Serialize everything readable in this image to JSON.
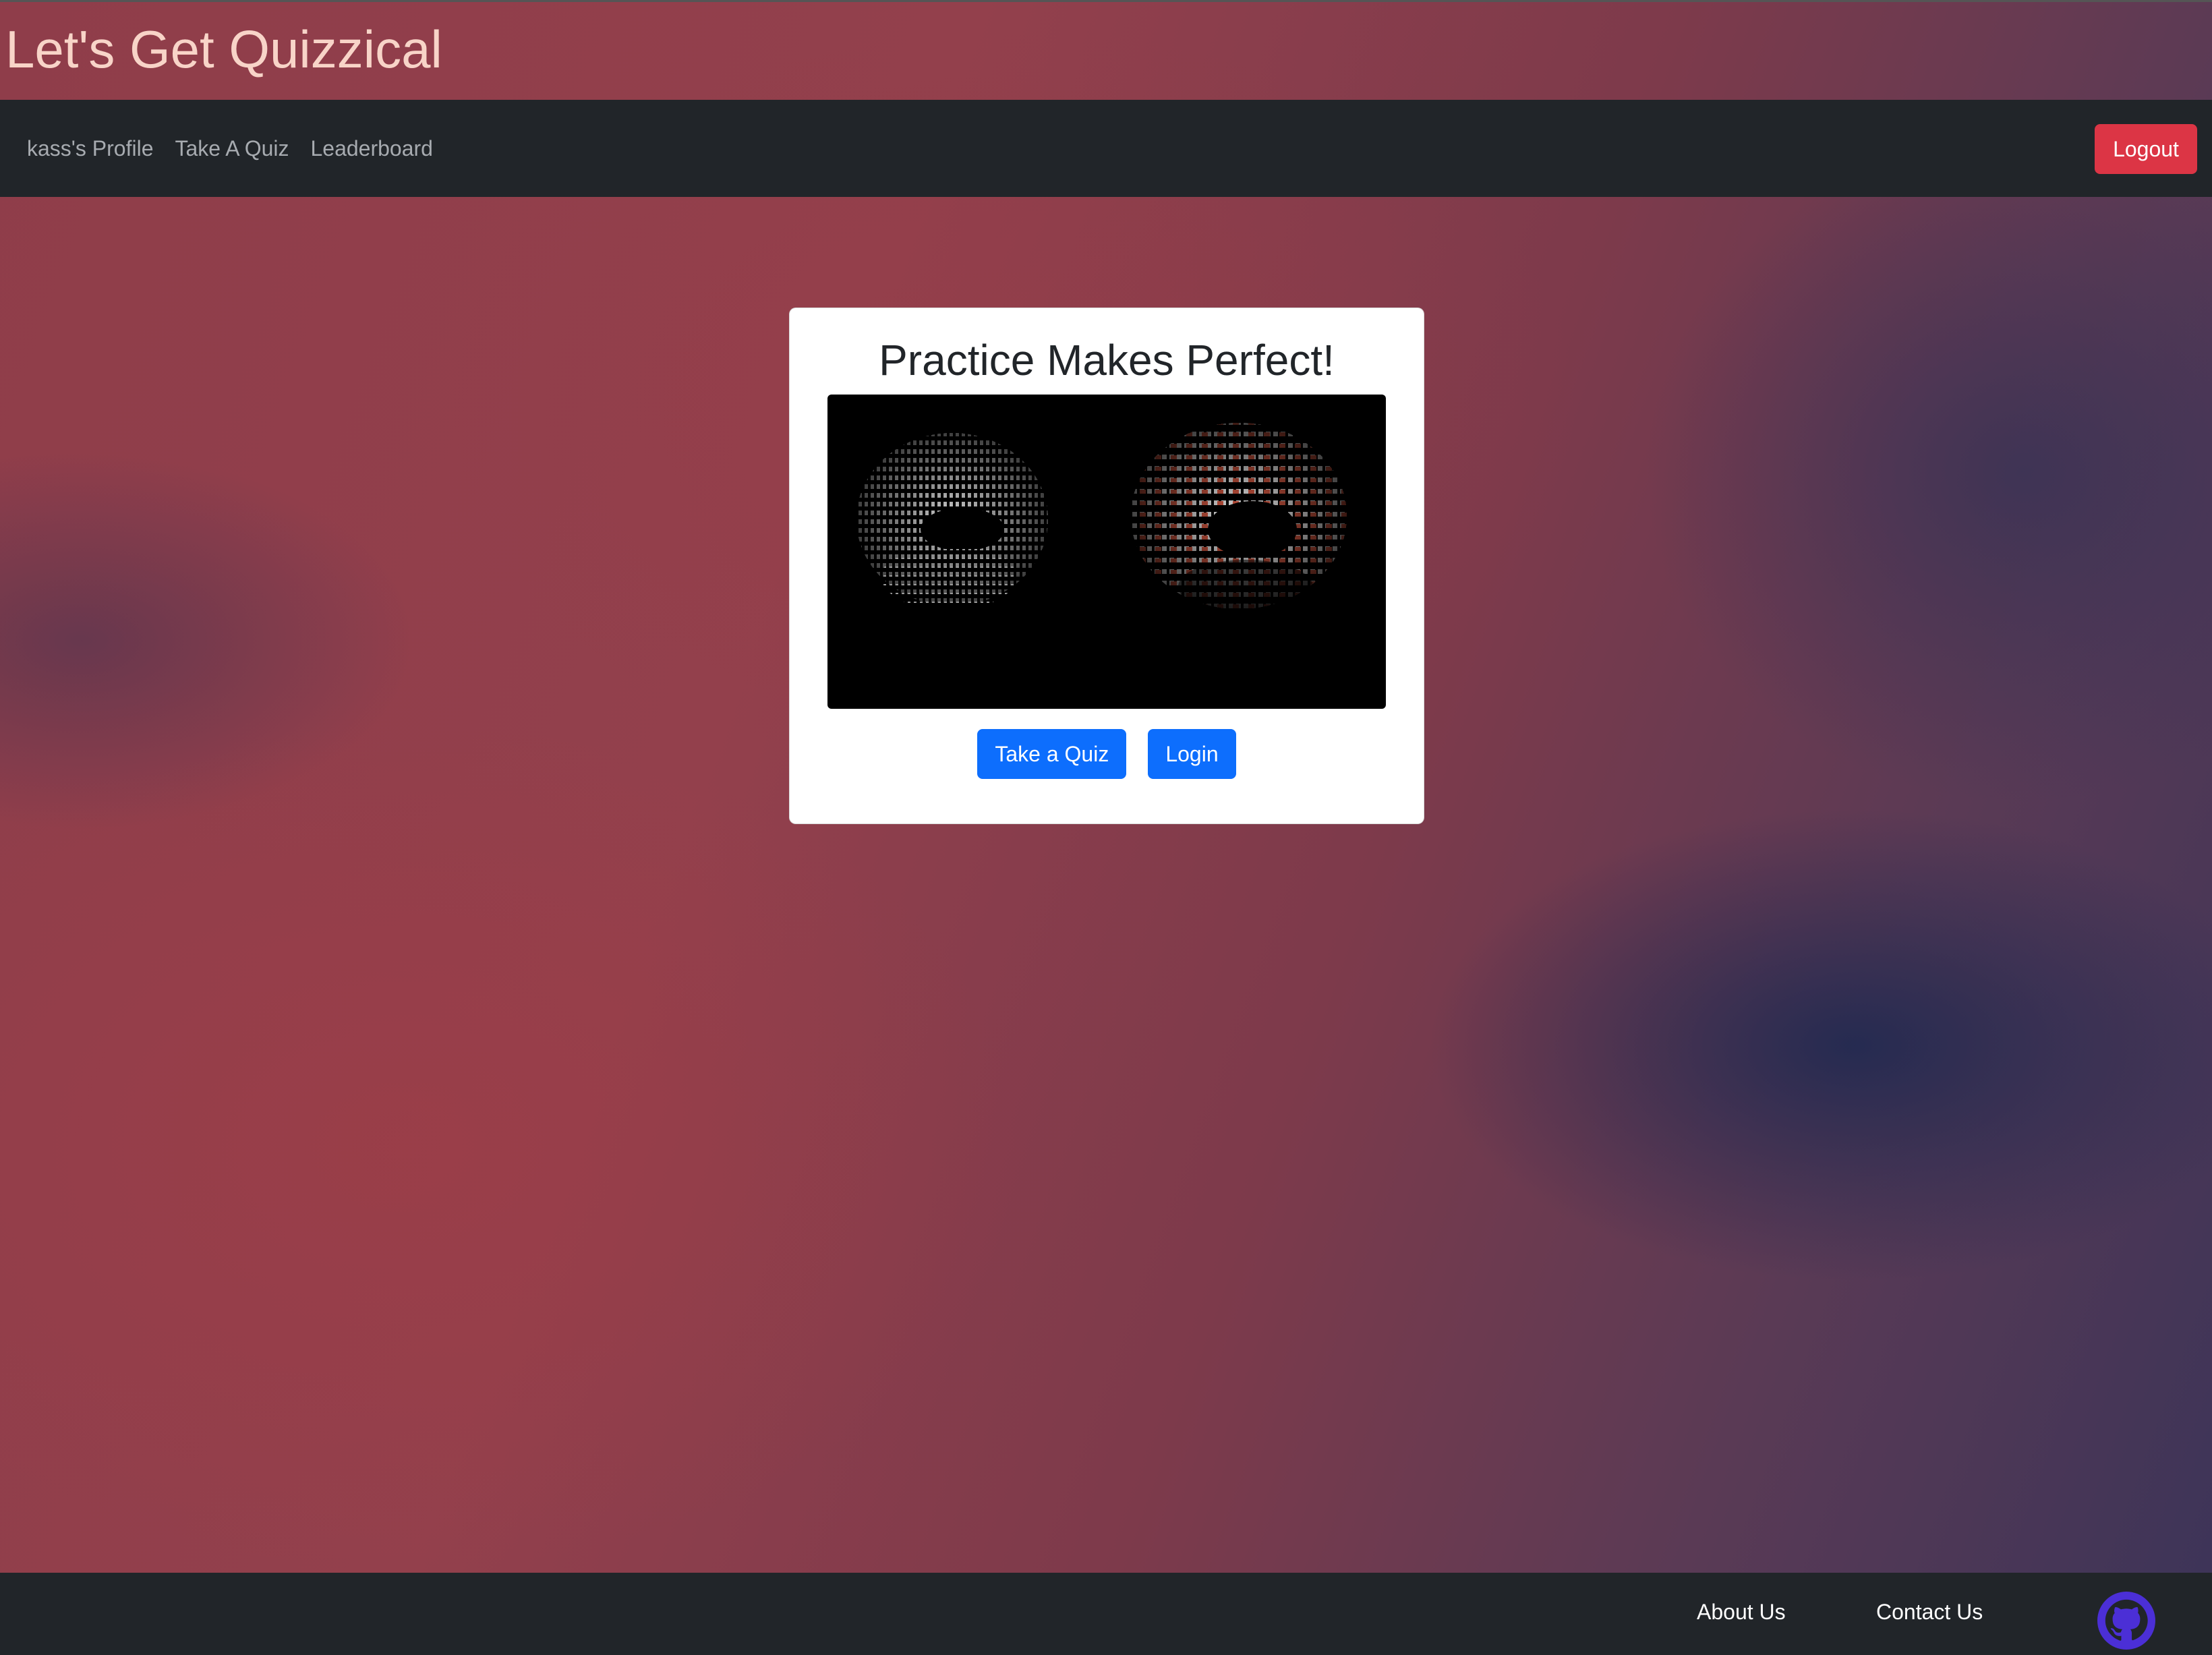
{
  "site": {
    "title": "Let's Get Quizzical"
  },
  "nav": {
    "items": [
      {
        "label": "kass's Profile"
      },
      {
        "label": "Take A Quiz"
      },
      {
        "label": "Leaderboard"
      }
    ],
    "logout_label": "Logout"
  },
  "hero": {
    "title": "Practice Makes Perfect!",
    "image_icon": "ascii-donut-image",
    "take_quiz_label": "Take a Quiz",
    "login_label": "Login"
  },
  "footer": {
    "about_label": "About Us",
    "contact_label": "Contact Us",
    "github_icon": "github-icon"
  },
  "colors": {
    "navbar": "#212529",
    "title_text": "#f8d4c8",
    "logout": "#dc3545",
    "primary": "#0d6efd",
    "github": "#4b2fd6"
  }
}
